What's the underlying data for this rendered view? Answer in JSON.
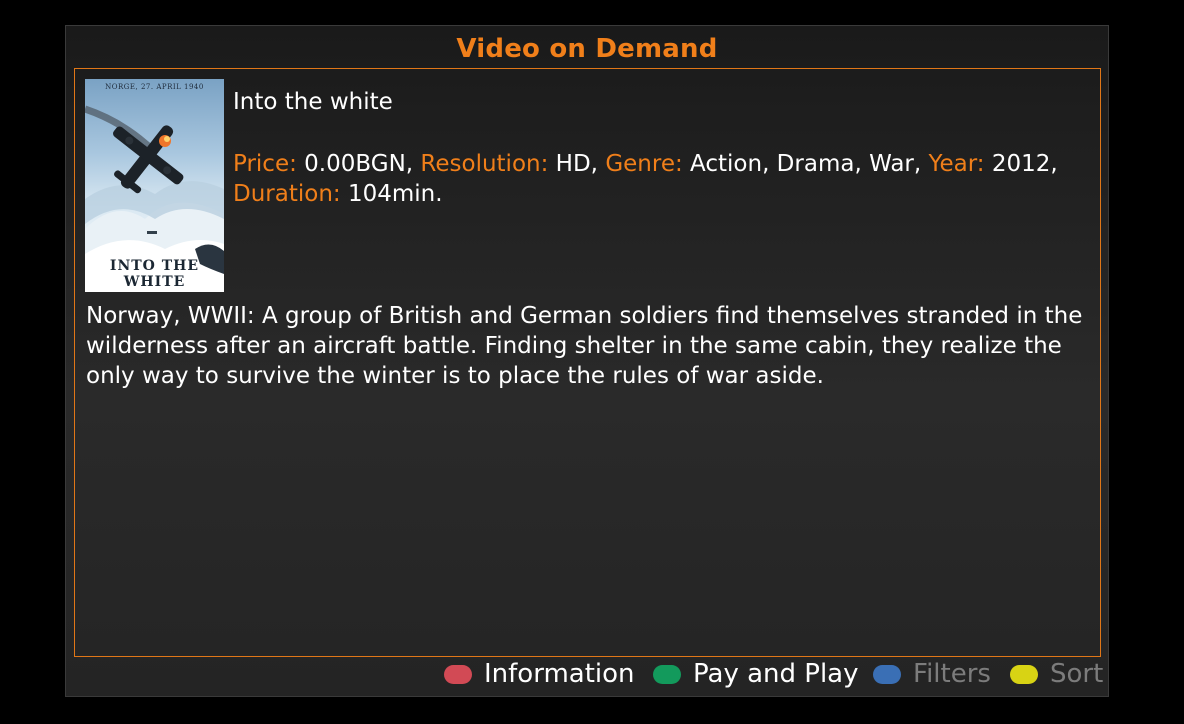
{
  "header": {
    "title": "Video on Demand"
  },
  "movie": {
    "poster": {
      "top_text": "NORGE, 27. APRIL 1940",
      "bottom_text": "INTO THE WHITE",
      "icon": "movie-poster-plane-icon"
    },
    "title": "Into the white",
    "labels": {
      "price": "Price:",
      "resolution": "Resolution:",
      "genre": "Genre:",
      "year": "Year:",
      "duration": "Duration:"
    },
    "values": {
      "price": "0.00BGN,",
      "resolution": "HD,",
      "genre": "Action, Drama, War,",
      "year": "2012,",
      "duration": "104min."
    },
    "description": "Norway, WWII: A group of British and German soldiers find themselves stranded in the wilderness after an aircraft battle. Finding shelter in the same cabin, they realize the only  way to survive the winter is to place the rules of war aside."
  },
  "footer": {
    "buttons": [
      {
        "label": "Information",
        "color": "#d24a55"
      },
      {
        "label": "Pay and Play",
        "color": "#139a5c"
      },
      {
        "label": "Filters",
        "color": "#3a6fb5"
      },
      {
        "label": "Sort",
        "color": "#d8d314"
      }
    ]
  },
  "colors": {
    "accent": "#f07f1a",
    "text": "#ffffff",
    "disabled": "#7c7c7c",
    "background": "#000000"
  }
}
